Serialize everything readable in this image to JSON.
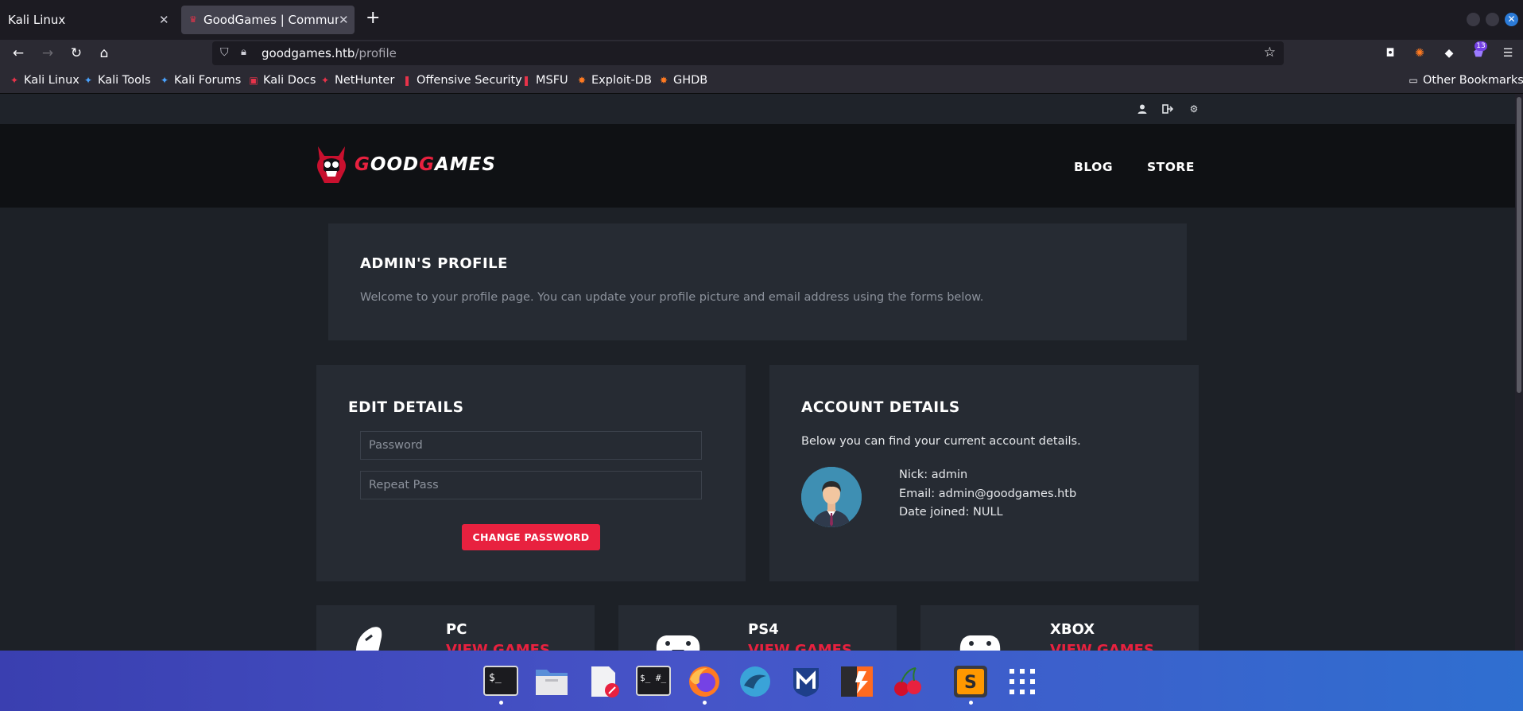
{
  "browser": {
    "tabs": [
      {
        "title": "Kali Linux",
        "active": false
      },
      {
        "title": "GoodGames | Community and",
        "active": true
      }
    ],
    "url": {
      "host": "goodgames.htb",
      "path": "/profile"
    },
    "extension_badge": "13",
    "bookmarks": [
      "Kali Linux",
      "Kali Tools",
      "Kali Forums",
      "Kali Docs",
      "NetHunter",
      "Offensive Security",
      "MSFU",
      "Exploit-DB",
      "GHDB"
    ],
    "other_bookmarks": "Other Bookmarks"
  },
  "site": {
    "logo": {
      "first": "G",
      "rest1": "OOD",
      "second": "G",
      "rest2": "AMES"
    },
    "nav": [
      "BLOG",
      "STORE"
    ],
    "hero": {
      "title": "ADMIN'S PROFILE",
      "text": "Welcome to your profile page. You can update your profile picture and email address using the forms below."
    },
    "edit": {
      "title": "EDIT DETAILS",
      "password_placeholder": "Password",
      "repeat_placeholder": "Repeat Pass",
      "button": "CHANGE PASSWORD"
    },
    "account": {
      "title": "ACCOUNT DETAILS",
      "subtitle": "Below you can find your current account details.",
      "nick": "Nick: admin",
      "email": "Email: admin@goodgames.htb",
      "joined": "Date joined: NULL"
    },
    "platforms": [
      {
        "name": "PC",
        "link": "VIEW GAMES"
      },
      {
        "name": "PS4",
        "link": "VIEW GAMES"
      },
      {
        "name": "XBOX",
        "link": "VIEW GAMES"
      }
    ]
  },
  "icons": {
    "top_strip": [
      "user-icon",
      "sign-out-icon",
      "settings-icon"
    ],
    "taskbar": [
      "terminal-icon",
      "files-icon",
      "text-editor-icon",
      "root-terminal-icon",
      "firefox-icon",
      "wireshark-icon",
      "metasploit-icon",
      "burpsuite-icon",
      "cherrytree-icon",
      "sublime-text-icon",
      "app-grid-icon"
    ]
  },
  "colors": {
    "accent": "#e8213f",
    "page_bg": "#1d2127",
    "card_bg": "#262b33"
  }
}
